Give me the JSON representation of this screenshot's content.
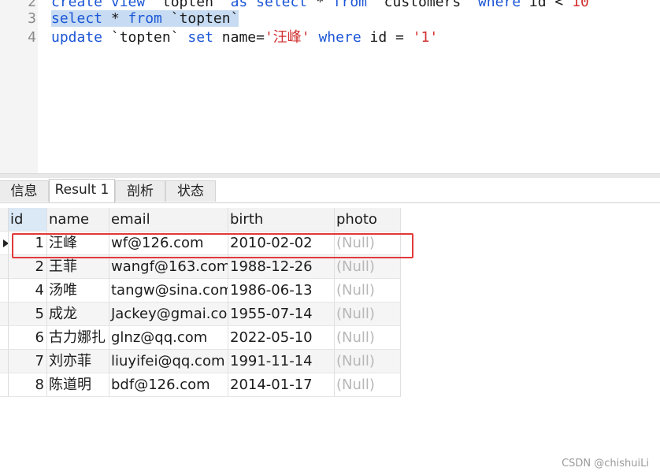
{
  "editor": {
    "lines": [
      {
        "num": "2",
        "tokens": [
          {
            "t": "create view ",
            "c": "kw"
          },
          {
            "t": "`topten` ",
            "c": "id"
          },
          {
            "t": "as select ",
            "c": "kw"
          },
          {
            "t": "* ",
            "c": "id"
          },
          {
            "t": "from ",
            "c": "kw"
          },
          {
            "t": "`customers` ",
            "c": "id"
          },
          {
            "t": "where ",
            "c": "kw"
          },
          {
            "t": "id < ",
            "c": "id"
          },
          {
            "t": "10",
            "c": "num"
          }
        ]
      },
      {
        "num": "3",
        "tokens": [
          {
            "t": "select",
            "c": "kw hl"
          },
          {
            "t": " * ",
            "c": "id hl"
          },
          {
            "t": "from",
            "c": "kw hl"
          },
          {
            "t": " `topten`",
            "c": "id hl"
          }
        ]
      },
      {
        "num": "4",
        "tokens": [
          {
            "t": "update ",
            "c": "kw"
          },
          {
            "t": "`topten` ",
            "c": "id"
          },
          {
            "t": "set ",
            "c": "kw"
          },
          {
            "t": "name=",
            "c": "id"
          },
          {
            "t": "'汪峰' ",
            "c": "str"
          },
          {
            "t": "where ",
            "c": "kw"
          },
          {
            "t": "id = ",
            "c": "id"
          },
          {
            "t": "'1'",
            "c": "str"
          }
        ]
      }
    ]
  },
  "tabs": [
    {
      "label": "信息"
    },
    {
      "label": "Result 1"
    },
    {
      "label": "剖析"
    },
    {
      "label": "状态"
    }
  ],
  "grid": {
    "columns": [
      "id",
      "name",
      "email",
      "birth",
      "photo"
    ],
    "rows": [
      [
        "1",
        "汪峰",
        "wf@126.com",
        "2010-02-02",
        "(Null)"
      ],
      [
        "2",
        "王菲",
        "wangf@163.com",
        "1988-12-26",
        "(Null)"
      ],
      [
        "4",
        "汤唯",
        "tangw@sina.com",
        "1986-06-13",
        "(Null)"
      ],
      [
        "5",
        "成龙",
        "Jackey@gmai.com",
        "1955-07-14",
        "(Null)"
      ],
      [
        "6",
        "古力娜扎",
        "glnz@qq.com",
        "2022-05-10",
        "(Null)"
      ],
      [
        "7",
        "刘亦菲",
        "liuyifei@qq.com",
        "1991-11-14",
        "(Null)"
      ],
      [
        "8",
        "陈道明",
        "bdf@126.com",
        "2014-01-17",
        "(Null)"
      ]
    ]
  },
  "watermark": "CSDN @chishuiLi",
  "colors": {
    "keyword": "#1a55d6",
    "string": "#d23030",
    "highlight": "#c7dcf2",
    "annotation_box": "#e03a3a",
    "null_text": "#b7b7b7"
  }
}
